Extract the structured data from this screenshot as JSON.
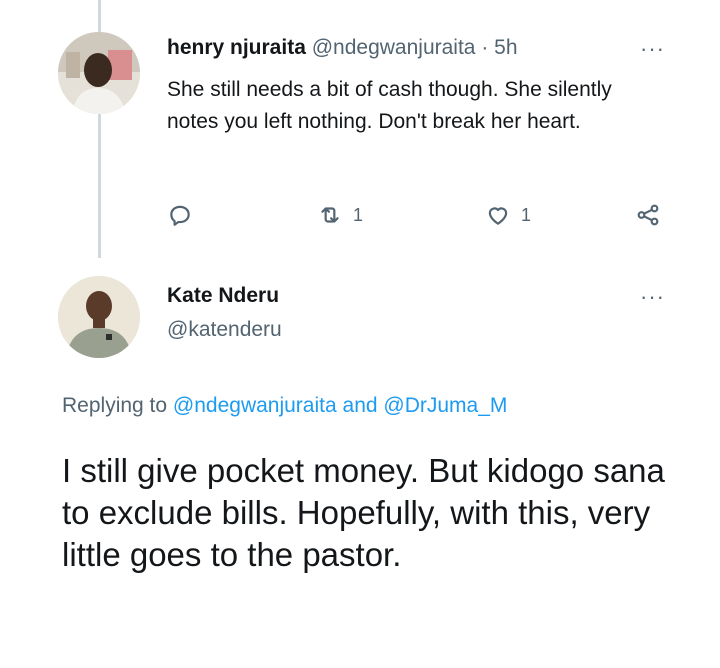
{
  "reply_tweet": {
    "author_name": "henry njuraita",
    "author_handle": "@ndegwanjuraita",
    "separator": "·",
    "time": "5h",
    "text": "She still needs a bit of cash though. She silently notes you left nothing. Don't break her heart.",
    "retweet_count": "1",
    "like_count": "1",
    "more_label": "···"
  },
  "main_tweet": {
    "author_name": "Kate Nderu",
    "author_handle": "@katenderu",
    "more_label": "···",
    "replying_prefix": "Replying to",
    "replying_mention_1": "@ndegwanjuraita",
    "replying_and": "and",
    "replying_mention_2": "@DrJuma_M",
    "text": "I still give pocket money. But kidogo sana to exclude bills. Hopefully, with this, very little goes to the pastor."
  },
  "colors": {
    "text_primary": "#14171a",
    "text_secondary": "#536471",
    "link": "#1d9bf0",
    "thread_line": "#cfd9de"
  },
  "icons": [
    "reply-icon",
    "retweet-icon",
    "like-icon",
    "share-icon",
    "more-icon"
  ]
}
